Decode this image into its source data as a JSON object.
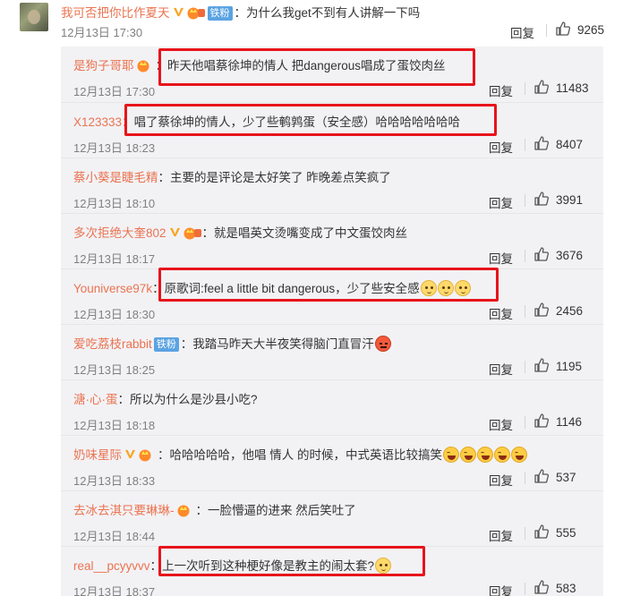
{
  "top_comment": {
    "user": "我可否把你比作夏天",
    "sep": "：",
    "text": "为什么我get不到有人讲解一下吗",
    "date": "12月13日 17:30",
    "reply_label": "回复",
    "likes": "9265"
  },
  "replies": [
    {
      "user": "是狗子哥耶",
      "sep": "：",
      "text": "昨天他唱蔡徐坤的情人 把dangerous唱成了蛋饺肉丝",
      "date": "12月13日 17:30",
      "reply_label": "回复",
      "likes": "11483"
    },
    {
      "user": "X123333",
      "sep": "：",
      "text": "唱了蔡徐坤的情人，少了些鹌鹑蛋（安全感）哈哈哈哈哈哈哈",
      "date": "12月13日 18:23",
      "reply_label": "回复",
      "likes": "8407"
    },
    {
      "user": "蔡小葵是睫毛精",
      "sep": "：",
      "text": "主要的是评论是太好笑了 昨晚差点笑疯了",
      "date": "12月13日 18:10",
      "reply_label": "回复",
      "likes": "3991"
    },
    {
      "user": "多次拒绝大奎802",
      "sep": "：",
      "text": "就是唱英文烫嘴变成了中文蛋饺肉丝",
      "date": "12月13日 18:17",
      "reply_label": "回复",
      "likes": "3676"
    },
    {
      "user": "Youniverse97k",
      "sep": "：",
      "text": "原歌词:feel a little bit dangerous，少了些安全感",
      "date": "12月13日 18:30",
      "reply_label": "回复",
      "likes": "2456"
    },
    {
      "user": "爱吃荔枝rabbit",
      "badge": "铁粉",
      "sep": "：",
      "text": "我踏马昨天大半夜笑得脑门直冒汗",
      "date": "12月13日 18:25",
      "reply_label": "回复",
      "likes": "1195"
    },
    {
      "user": "溏·心·蛋",
      "sep": "：",
      "text": "所以为什么是沙县小吃?",
      "date": "12月13日 18:18",
      "reply_label": "回复",
      "likes": "1146"
    },
    {
      "user": "奶味星际",
      "sep": "：",
      "text": "哈哈哈哈哈，他唱 情人 的时候，中式英语比较搞笑",
      "date": "12月13日 18:33",
      "reply_label": "回复",
      "likes": "537"
    },
    {
      "user": "去冰去淇只要琳琳-",
      "sep": "：",
      "text": "一脸懵逼的进来 然后笑吐了",
      "date": "12月13日 18:44",
      "reply_label": "回复",
      "likes": "555"
    },
    {
      "user": "real__pcyyvvv",
      "sep": "：",
      "text": "上一次听到这种梗好像是教主的闹太套?",
      "date": "12月13日 18:37",
      "reply_label": "回复",
      "likes": "583"
    }
  ],
  "top_badge": "铁粉",
  "colors": {
    "username": "#eb7350",
    "highlight": "#e8141b",
    "panel": "#f2f2f5",
    "fan_badge": "#5ba3e2"
  },
  "icons": {
    "like": "thumbs-up-icon",
    "verified": "v-badge-icon",
    "member": "crown-badge-icon"
  }
}
